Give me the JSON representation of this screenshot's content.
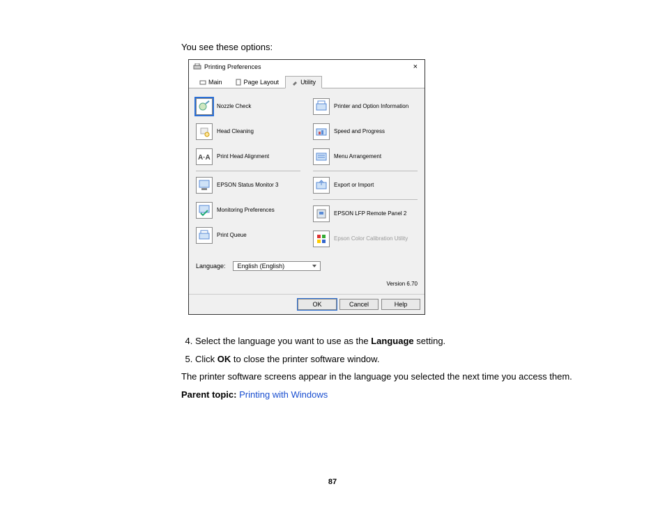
{
  "intro": "You see these options:",
  "dialog": {
    "title": "Printing Preferences",
    "close": "×",
    "tabs": [
      {
        "label": "Main"
      },
      {
        "label": "Page Layout"
      },
      {
        "label": "Utility"
      }
    ],
    "left": [
      {
        "name": "nozzle-check",
        "label": "Nozzle Check",
        "selected": true
      },
      {
        "name": "head-cleaning",
        "label": "Head Cleaning"
      },
      {
        "name": "print-head-align",
        "label": "Print Head Alignment"
      },
      {
        "name": "sep"
      },
      {
        "name": "status-monitor",
        "label": "EPSON Status Monitor 3"
      },
      {
        "name": "monitor-prefs",
        "label": "Monitoring Preferences"
      },
      {
        "name": "print-queue",
        "label": "Print Queue"
      }
    ],
    "right": [
      {
        "name": "printer-info",
        "label": "Printer and Option Information"
      },
      {
        "name": "speed-progress",
        "label": "Speed and Progress"
      },
      {
        "name": "menu-arrangement",
        "label": "Menu Arrangement"
      },
      {
        "name": "sep"
      },
      {
        "name": "export-import",
        "label": "Export or Import"
      },
      {
        "name": "sep"
      },
      {
        "name": "lfp-remote",
        "label": "EPSON LFP Remote Panel 2"
      },
      {
        "name": "color-calib",
        "label": "Epson Color Calibration Utility",
        "disabled": true
      }
    ],
    "language_label": "Language:",
    "language_value": "English (English)",
    "version": "Version 6.70",
    "buttons": {
      "ok": "OK",
      "cancel": "Cancel",
      "help": "Help"
    }
  },
  "steps": {
    "s4_a": "Select the language you want to use as the ",
    "s4_b": "Language",
    "s4_c": " setting.",
    "s5_a": "Click ",
    "s5_b": "OK",
    "s5_c": " to close the printer software window."
  },
  "after": "The printer software screens appear in the language you selected the next time you access them.",
  "parent_label": "Parent topic:",
  "parent_link": "Printing with Windows",
  "pagenum": "87"
}
